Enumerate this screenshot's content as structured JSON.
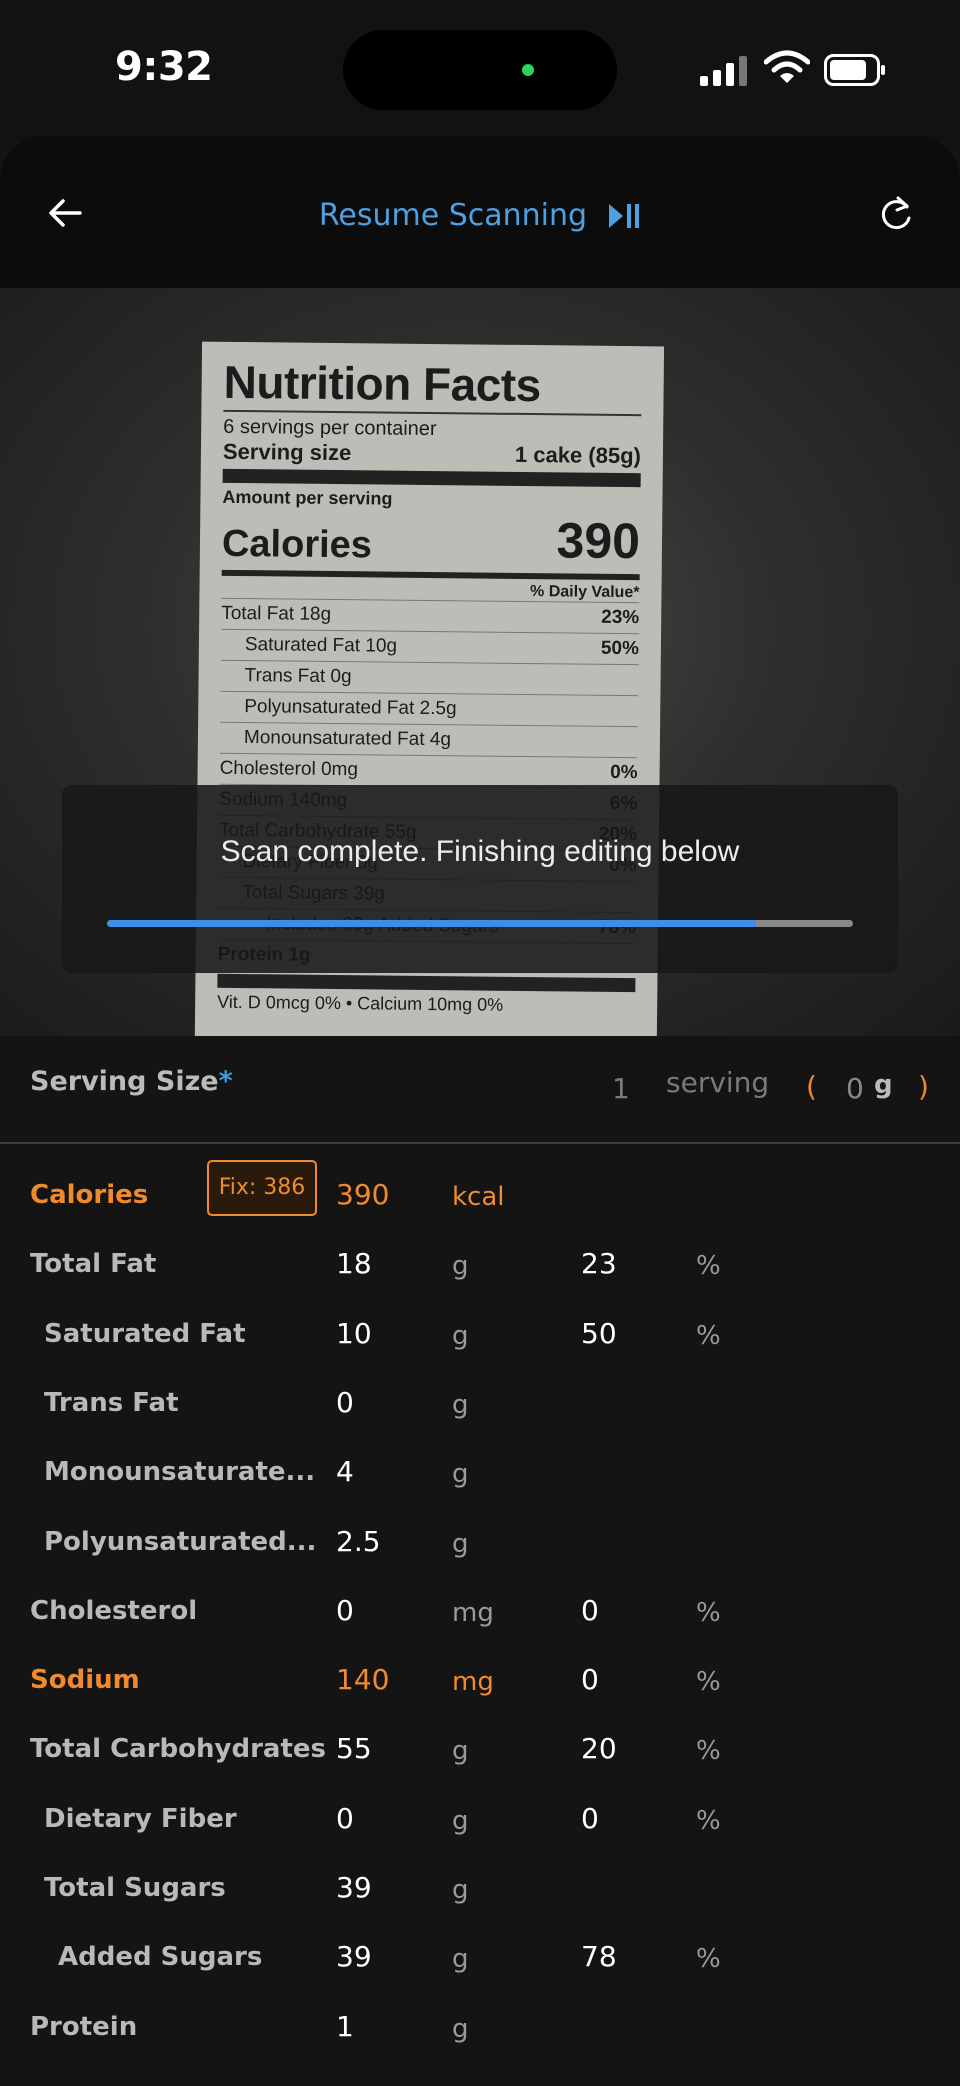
{
  "status_bar": {
    "time": "9:32"
  },
  "header": {
    "resume_label": "Resume Scanning"
  },
  "scanned_label": {
    "title": "Nutrition Facts",
    "servings_per_container": "6 servings per container",
    "serving_size_label": "Serving size",
    "serving_size_value": "1 cake (85g)",
    "amount_per_serving": "Amount per serving",
    "calories_label": "Calories",
    "calories_value": "390",
    "daily_value_header": "% Daily Value*",
    "rows": [
      {
        "name": "Total Fat 18g",
        "dv": "23%"
      },
      {
        "name": "Saturated Fat 10g",
        "dv": "50%"
      },
      {
        "name": "Trans Fat 0g",
        "dv": ""
      },
      {
        "name": "Polyunsaturated Fat 2.5g",
        "dv": ""
      },
      {
        "name": "Monounsaturated Fat 4g",
        "dv": ""
      },
      {
        "name": "Cholesterol 0mg",
        "dv": "0%"
      },
      {
        "name": "Sodium 140mg",
        "dv": "6%"
      },
      {
        "name": "Total Carbohydrate 55g",
        "dv": "20%"
      },
      {
        "name": "Dietary Fiber 0g",
        "dv": "0%"
      },
      {
        "name": "Total Sugars 39g",
        "dv": ""
      },
      {
        "name": "Includes 39g Added Sugars",
        "dv": "78%"
      },
      {
        "name": "Protein 1g",
        "dv": ""
      }
    ],
    "footer": "Vit. D 0mcg 0%   •   Calcium 10mg 0%"
  },
  "toast": {
    "message": "Scan complete. Finishing editing below",
    "progress": 0.87
  },
  "serving": {
    "label": "Serving Size",
    "required_mark": "*",
    "quantity": "1",
    "unit": "serving",
    "paren_open": "(",
    "grams_value": "0",
    "grams_unit": "g",
    "paren_close": ")"
  },
  "nutrients": [
    {
      "name": "Calories",
      "value": "390",
      "unit": "kcal",
      "dv": "",
      "pct": "",
      "fix": "Fix: 386"
    },
    {
      "name": "Total Fat",
      "value": "18",
      "unit": "g",
      "dv": "23",
      "pct": "%"
    },
    {
      "name": "Saturated Fat",
      "value": "10",
      "unit": "g",
      "dv": "50",
      "pct": "%"
    },
    {
      "name": "Trans Fat",
      "value": "0",
      "unit": "g",
      "dv": "",
      "pct": ""
    },
    {
      "name": "Monounsaturate...",
      "value": "4",
      "unit": "g",
      "dv": "",
      "pct": ""
    },
    {
      "name": "Polyunsaturated...",
      "value": "2.5",
      "unit": "g",
      "dv": "",
      "pct": ""
    },
    {
      "name": "Cholesterol",
      "value": "0",
      "unit": "mg",
      "dv": "0",
      "pct": "%"
    },
    {
      "name": "Sodium",
      "value": "140",
      "unit": "mg",
      "dv": "0",
      "pct": "%"
    },
    {
      "name": "Total Carbohydrates",
      "value": "55",
      "unit": "g",
      "dv": "20",
      "pct": "%"
    },
    {
      "name": "Dietary Fiber",
      "value": "0",
      "unit": "g",
      "dv": "0",
      "pct": "%"
    },
    {
      "name": "Total Sugars",
      "value": "39",
      "unit": "g",
      "dv": "",
      "pct": ""
    },
    {
      "name": "Added Sugars",
      "value": "39",
      "unit": "g",
      "dv": "78",
      "pct": "%"
    },
    {
      "name": "Protein",
      "value": "1",
      "unit": "g",
      "dv": "",
      "pct": ""
    }
  ],
  "colors": {
    "accent_blue": "#4f9fe3",
    "warning_orange": "#f08a2e",
    "background": "#131313"
  },
  "icons": [
    "back-arrow-icon",
    "play-pause-icon",
    "refresh-icon",
    "signal-icon",
    "wifi-icon",
    "battery-icon"
  ]
}
